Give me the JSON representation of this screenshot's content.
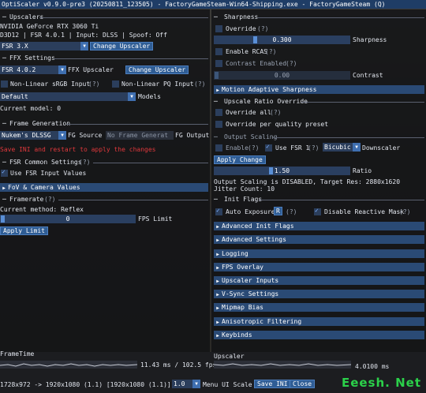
{
  "title": "OptiScaler v0.9.0-pre3 (20250811_123505) - FactoryGameSteam-Win64-Shipping.exe - FactoryGameSteam (Q)",
  "left": {
    "upscalers_header": "Upscalers",
    "gpu": "NVIDIA GeForce RTX 3060 Ti",
    "api_line": "D3D12 | FSR 4.0.1 | Input: DLSS | Spoof: Off",
    "upscaler_select": "FSR 3.X",
    "change_upscaler_btn": "Change Upscaler",
    "ffx_header": "FFX Settings",
    "ffx_select": "FSR 4.0.2",
    "ffx_upscaler_label": "FFX Upscaler",
    "ffx_change_btn": "Change Upscaler",
    "nonlinear_srgb": "Non-Linear sRGB Input",
    "nonlinear_pq": "Non-Linear PQ Input",
    "help": "(?)",
    "models_select": "Default",
    "models_label": "Models",
    "current_model": "Current model: 0",
    "fg_header": "Frame Generation",
    "fg_select": "Nukem's DLSSG",
    "fg_source_label": "FG Source",
    "fg_output_select": "No Frame Generat",
    "fg_output_label": "FG Output",
    "save_warning": "Save INI and restart to apply the changes",
    "fsr_common_header": "FSR Common Settings",
    "use_fsr_input": "Use FSR Input Values",
    "fov_camera": "FoV & Camera Values",
    "framerate_header": "Framerate",
    "current_method": "Current method: Reflex",
    "fps_value": "0",
    "fps_label": "FPS Limit",
    "apply_limit": "Apply Limit"
  },
  "right": {
    "sharpness_header": "Sharpness",
    "override": "Override",
    "sharpness_value": "0.300",
    "sharpness_label": "Sharpness",
    "enable_rcas": "Enable RCAS",
    "contrast_enabled": "Contrast Enabled",
    "contrast_value": "0.00",
    "contrast_label": "Contrast",
    "motion_sharpness": "Motion Adaptive Sharpness",
    "ratio_header": "Upscale Ratio Override",
    "override_all": "Override all",
    "override_quality": "Override per quality preset",
    "output_header": "Output Scaling",
    "enable": "Enable",
    "use_fsr1": "Use FSR 1",
    "bicubic": "Bicubic",
    "downscaler": "Downscaler",
    "apply_change": "Apply Change",
    "ratio_value": "1.50",
    "ratio_label": "Ratio",
    "output_status": "Output Scaling is DISABLED, Target Res: 2880x1620",
    "jitter": "Jitter Count: 10",
    "init_header": "Init Flags",
    "auto_exposure": "Auto Exposure",
    "r_btn": "R",
    "disable_reactive": "Disable Reactive Mask",
    "collapsibles": [
      "Advanced Init Flags",
      "Advanced Settings",
      "Logging",
      "FPS Overlay",
      "Upscaler Inputs",
      "V-Sync Settings",
      "Mipmap Bias",
      "Anisotropic Filtering",
      "Keybinds"
    ]
  },
  "bottom": {
    "frametime_label": "FrameTime",
    "frametime_value": "11.43 ms / 102.5 fps",
    "upscaler_label": "Upscaler",
    "upscaler_value": "4.0100 ms",
    "res_line": "1728x972 -> 1920x1080 (1.1) [1920x1080 (1.1)] 2578",
    "scale_value": "1.0",
    "menu_scale_label": "Menu UI Scale",
    "save_ini": "Save INI",
    "close": "Close"
  },
  "watermark": "Eeesh. Net"
}
